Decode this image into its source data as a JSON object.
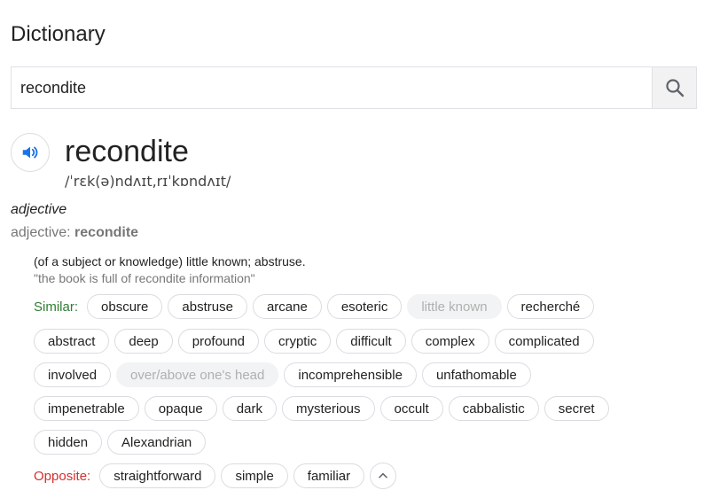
{
  "header": {
    "title": "Dictionary"
  },
  "search": {
    "value": "recondite",
    "button_icon": "search-icon"
  },
  "entry": {
    "word": "recondite",
    "phonetic": "/ˈrɛk(ə)ndʌɪt,rɪˈkɒndʌɪt/",
    "pos": "adjective",
    "pos_label": "adjective: ",
    "pos_word": "recondite",
    "definition": "(of a subject or knowledge) little known; abstruse.",
    "example": "\"the book is full of recondite information\""
  },
  "similar": {
    "label": "Similar:",
    "rows": [
      [
        {
          "text": "obscure",
          "muted": false
        },
        {
          "text": "abstruse",
          "muted": false
        },
        {
          "text": "arcane",
          "muted": false
        },
        {
          "text": "esoteric",
          "muted": false
        },
        {
          "text": "little known",
          "muted": true
        },
        {
          "text": "recherché",
          "muted": false
        }
      ],
      [
        {
          "text": "abstract",
          "muted": false
        },
        {
          "text": "deep",
          "muted": false
        },
        {
          "text": "profound",
          "muted": false
        },
        {
          "text": "cryptic",
          "muted": false
        },
        {
          "text": "difficult",
          "muted": false
        },
        {
          "text": "complex",
          "muted": false
        },
        {
          "text": "complicated",
          "muted": false
        }
      ],
      [
        {
          "text": "involved",
          "muted": false
        },
        {
          "text": "over/above one's head",
          "muted": true
        },
        {
          "text": "incomprehensible",
          "muted": false
        },
        {
          "text": "unfathomable",
          "muted": false
        }
      ],
      [
        {
          "text": "impenetrable",
          "muted": false
        },
        {
          "text": "opaque",
          "muted": false
        },
        {
          "text": "dark",
          "muted": false
        },
        {
          "text": "mysterious",
          "muted": false
        },
        {
          "text": "occult",
          "muted": false
        },
        {
          "text": "cabbalistic",
          "muted": false
        },
        {
          "text": "secret",
          "muted": false
        }
      ],
      [
        {
          "text": "hidden",
          "muted": false
        },
        {
          "text": "Alexandrian",
          "muted": false
        }
      ]
    ]
  },
  "opposite": {
    "label": "Opposite:",
    "chips": [
      {
        "text": "straightforward",
        "muted": false
      },
      {
        "text": "simple",
        "muted": false
      },
      {
        "text": "familiar",
        "muted": false
      }
    ]
  },
  "colors": {
    "similar_label": "#2e7d32",
    "opposite_label": "#d32f2f",
    "speaker_icon": "#1a73e8"
  }
}
